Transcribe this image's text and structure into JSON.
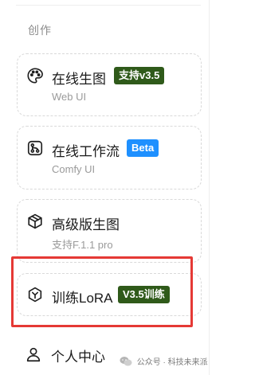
{
  "section": {
    "label": "创作"
  },
  "cards": [
    {
      "title": "在线生图",
      "subtitle": "Web UI",
      "badge": "支持v3.5",
      "badge_color": "#2f5a1a",
      "icon": "palette-icon"
    },
    {
      "title": "在线工作流",
      "subtitle": "Comfy UI",
      "badge": "Beta",
      "badge_color": "#1e90ff",
      "icon": "workflow-icon"
    },
    {
      "title": "高级版生图",
      "subtitle": "支持F.1.1 pro",
      "icon": "cube-icon"
    },
    {
      "title": "训练LoRA",
      "badge": "V3.5训练",
      "badge_color": "#2f5a1a",
      "icon": "lora-icon"
    }
  ],
  "profile": {
    "label": "个人中心",
    "icon": "user-icon"
  },
  "watermark": {
    "text": "公众号 · 科技未来派"
  },
  "colors": {
    "highlight": "#e53935",
    "card_border": "#d9d9d9",
    "muted_text": "#9a9a9a"
  }
}
